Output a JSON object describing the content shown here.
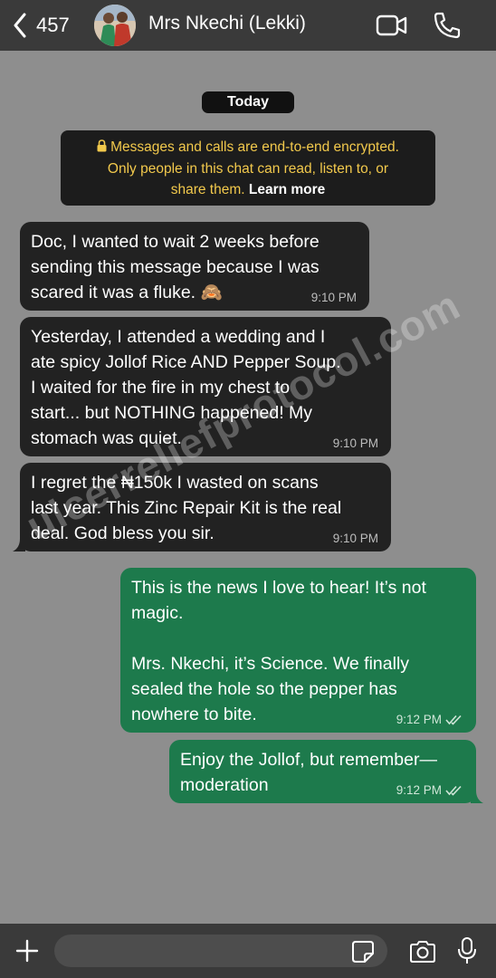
{
  "header": {
    "back_count": "457",
    "contact_name": "Mrs Nkechi (Lekki)",
    "icons": [
      "chevron-left-icon",
      "video-call-icon",
      "phone-call-icon"
    ]
  },
  "chat": {
    "date_chip": "Today",
    "encryption": {
      "line1": "Messages and calls are end-to-end encrypted.",
      "line2": "Only people in this chat can read, listen to, or",
      "line3_prefix": "share them. ",
      "learn_more": "Learn more"
    },
    "messages": [
      {
        "direction": "in",
        "lines": [
          "Doc, I wanted to wait 2 weeks before",
          "sending this message because I was",
          "scared it was a fluke. 🙈"
        ],
        "time": "9:10 PM"
      },
      {
        "direction": "in",
        "lines": [
          "Yesterday, I attended a wedding and I",
          "ate spicy Jollof Rice AND Pepper Soup.",
          "I waited for the fire in my chest to",
          "start... but NOTHING happened! My",
          "stomach was quiet."
        ],
        "time": "9:10 PM"
      },
      {
        "direction": "in",
        "lines": [
          "I regret the ₦150k I wasted on scans",
          "last year. This Zinc Repair Kit is the real",
          "deal. God bless you sir."
        ],
        "time": "9:10 PM"
      },
      {
        "direction": "out",
        "lines": [
          "This is the news I love to hear! It’s not",
          "magic.",
          "",
          "Mrs. Nkechi, it’s Science. We finally",
          "sealed the hole so the pepper has",
          "nowhere to bite."
        ],
        "time": "9:12 PM",
        "status": "read"
      },
      {
        "direction": "out",
        "lines": [
          "Enjoy the Jollof, but remember—",
          "moderation"
        ],
        "time": "9:12 PM",
        "status": "read"
      }
    ],
    "watermark": "ulcerreliefprotocol.com"
  },
  "composer": {
    "placeholder": "",
    "icons": [
      "plus-icon",
      "sticker-icon",
      "camera-icon",
      "microphone-icon"
    ]
  },
  "colors": {
    "chat_bg": "#8e8e8e",
    "bar_bg": "#3a3a3a",
    "incoming_bubble": "#222222",
    "outgoing_bubble": "#1d7a4c",
    "encryption_text": "#f2c94c"
  }
}
